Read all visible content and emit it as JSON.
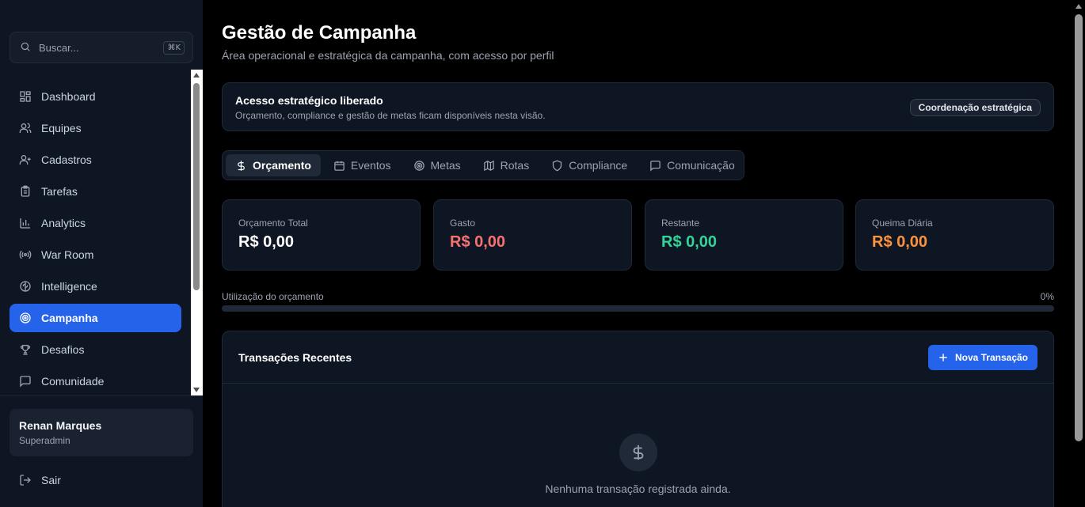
{
  "sidebar": {
    "search": {
      "placeholder": "Buscar...",
      "shortcut": "⌘K"
    },
    "items": [
      {
        "label": "Dashboard",
        "icon": "layout-dashboard-icon"
      },
      {
        "label": "Equipes",
        "icon": "users-icon"
      },
      {
        "label": "Cadastros",
        "icon": "user-plus-icon"
      },
      {
        "label": "Tarefas",
        "icon": "clipboard-list-icon"
      },
      {
        "label": "Analytics",
        "icon": "bar-chart-icon"
      },
      {
        "label": "War Room",
        "icon": "radio-icon"
      },
      {
        "label": "Intelligence",
        "icon": "brain-icon"
      },
      {
        "label": "Campanha",
        "icon": "target-icon",
        "active": true
      },
      {
        "label": "Desafios",
        "icon": "trophy-icon"
      },
      {
        "label": "Comunidade",
        "icon": "message-square-icon"
      }
    ],
    "user": {
      "name": "Renan Marques",
      "role": "Superadmin"
    },
    "logout_label": "Sair"
  },
  "header": {
    "title": "Gestão de Campanha",
    "subtitle": "Área operacional e estratégica da campanha, com acesso por perfil"
  },
  "access": {
    "title": "Acesso estratégico liberado",
    "description": "Orçamento, compliance e gestão de metas ficam disponíveis nesta visão.",
    "badge": "Coordenação estratégica"
  },
  "tabs": [
    {
      "label": "Orçamento",
      "icon": "dollar-icon",
      "active": true
    },
    {
      "label": "Eventos",
      "icon": "calendar-icon"
    },
    {
      "label": "Metas",
      "icon": "target-icon"
    },
    {
      "label": "Rotas",
      "icon": "map-icon"
    },
    {
      "label": "Compliance",
      "icon": "shield-icon"
    },
    {
      "label": "Comunicação",
      "icon": "message-square-icon"
    }
  ],
  "stats": [
    {
      "label": "Orçamento Total",
      "value": "R$ 0,00",
      "color": "#ffffff"
    },
    {
      "label": "Gasto",
      "value": "R$ 0,00",
      "color": "#f87171"
    },
    {
      "label": "Restante",
      "value": "R$ 0,00",
      "color": "#34d399"
    },
    {
      "label": "Queima Diária",
      "value": "R$ 0,00",
      "color": "#fb923c"
    }
  ],
  "utilization": {
    "label": "Utilização do orçamento",
    "percent_label": "0%",
    "value": 0
  },
  "transactions": {
    "title": "Transações Recentes",
    "new_button": "Nova Transação",
    "empty_text": "Nenhuma transação registrada ainda."
  },
  "colors": {
    "accent": "#2563eb",
    "background": "#000000",
    "panel": "#0f1623"
  }
}
